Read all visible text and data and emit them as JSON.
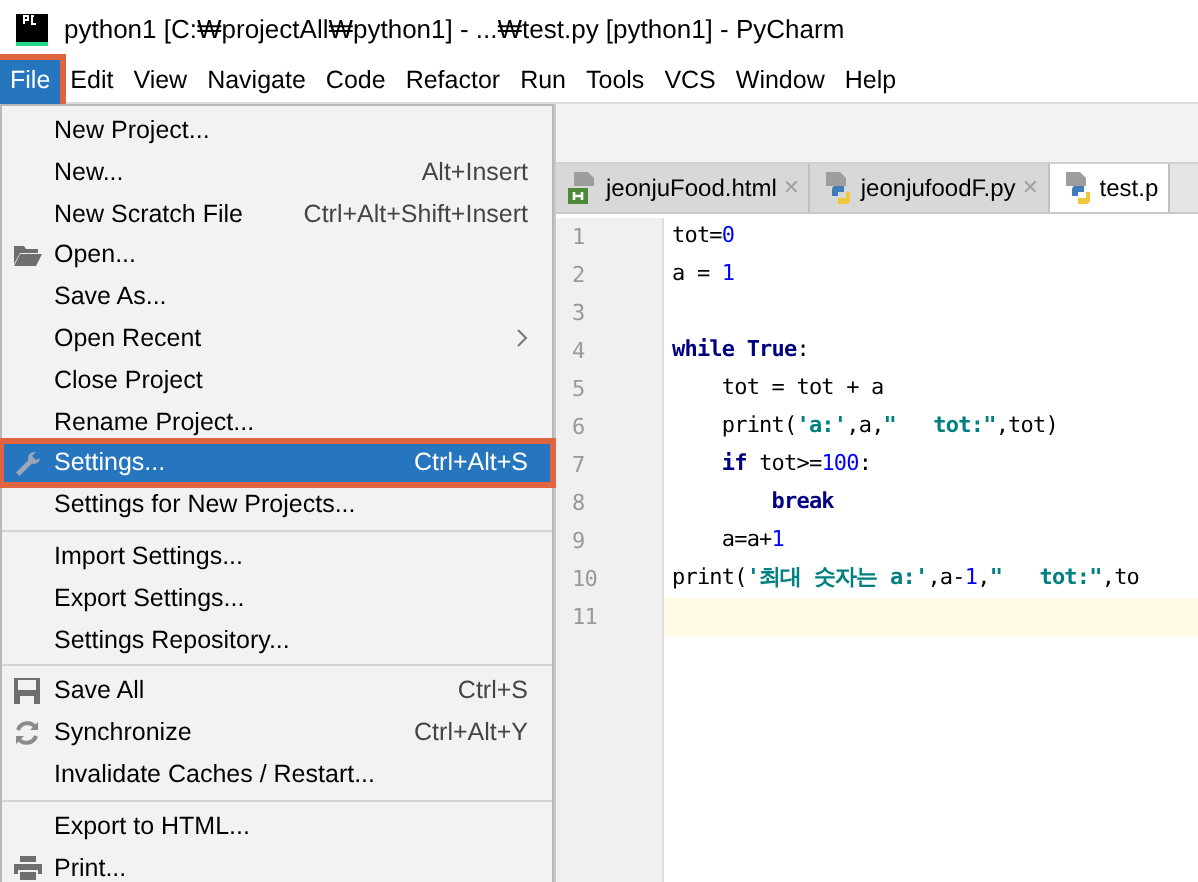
{
  "window": {
    "title": "python1 [C:₩projectAll₩python1] - ...₩test.py [python1] - PyCharm"
  },
  "menu_bar": [
    {
      "label": "File",
      "selected": true
    },
    {
      "label": "Edit",
      "selected": false
    },
    {
      "label": "View",
      "selected": false
    },
    {
      "label": "Navigate",
      "selected": false
    },
    {
      "label": "Code",
      "selected": false
    },
    {
      "label": "Refactor",
      "selected": false
    },
    {
      "label": "Run",
      "selected": false
    },
    {
      "label": "Tools",
      "selected": false
    },
    {
      "label": "VCS",
      "selected": false
    },
    {
      "label": "Window",
      "selected": false
    },
    {
      "label": "Help",
      "selected": false
    }
  ],
  "file_menu": [
    {
      "kind": "item",
      "label": "New Project...",
      "selected": false
    },
    {
      "kind": "item",
      "label": "New...",
      "shortcut": "Alt+Insert",
      "selected": false
    },
    {
      "kind": "item",
      "label": "New Scratch File",
      "shortcut": "Ctrl+Alt+Shift+Insert",
      "selected": false
    },
    {
      "kind": "item",
      "label": "Open...",
      "selected": false
    },
    {
      "kind": "item",
      "label": "Save As...",
      "selected": false
    },
    {
      "kind": "item",
      "label": "Open Recent",
      "submenu": true,
      "selected": false
    },
    {
      "kind": "item",
      "label": "Close Project",
      "selected": false
    },
    {
      "kind": "item",
      "label": "Rename Project...",
      "selected": false
    },
    {
      "kind": "item",
      "label": "Settings...",
      "shortcut": "Ctrl+Alt+S",
      "selected": true
    },
    {
      "kind": "item",
      "label": "Settings for New Projects...",
      "selected": false
    },
    {
      "kind": "separator"
    },
    {
      "kind": "item",
      "label": "Import Settings...",
      "selected": false
    },
    {
      "kind": "item",
      "label": "Export Settings...",
      "selected": false
    },
    {
      "kind": "item",
      "label": "Settings Repository...",
      "selected": false
    },
    {
      "kind": "separator"
    },
    {
      "kind": "item",
      "label": "Save All",
      "shortcut": "Ctrl+S",
      "selected": false
    },
    {
      "kind": "item",
      "label": "Synchronize",
      "shortcut": "Ctrl+Alt+Y",
      "selected": false
    },
    {
      "kind": "item",
      "label": "Invalidate Caches / Restart...",
      "selected": false
    },
    {
      "kind": "separator"
    },
    {
      "kind": "item",
      "label": "Export to HTML...",
      "selected": false
    },
    {
      "kind": "item",
      "label": "Print...",
      "selected": false
    }
  ],
  "editor_tabs": [
    {
      "label": "jeonjuFood.html",
      "kind": "html",
      "close": "✕",
      "selected": false
    },
    {
      "label": "jeonjufoodF.py",
      "kind": "python",
      "close": "✕",
      "selected": false
    },
    {
      "label": "test.p",
      "kind": "python",
      "selected": true
    }
  ],
  "code_lines": [
    {
      "number": "1",
      "current": false,
      "tokens": [
        {
          "kind": "plain",
          "text": "tot="
        },
        {
          "kind": "number",
          "text": "0"
        }
      ]
    },
    {
      "number": "2",
      "current": false,
      "tokens": [
        {
          "kind": "plain",
          "text": "a = "
        },
        {
          "kind": "number",
          "text": "1"
        }
      ]
    },
    {
      "number": "3",
      "current": false
    },
    {
      "number": "4",
      "current": false,
      "tokens": [
        {
          "kind": "keyword",
          "text": "while True"
        },
        {
          "kind": "plain",
          "text": ":"
        }
      ]
    },
    {
      "number": "5",
      "current": false,
      "tokens": [
        {
          "kind": "plain",
          "text": "    tot = tot + a"
        }
      ]
    },
    {
      "number": "6",
      "current": false,
      "tokens": [
        {
          "kind": "plain",
          "text": "    print("
        },
        {
          "kind": "string",
          "text": "'a:'"
        },
        {
          "kind": "plain",
          "text": ",a,"
        },
        {
          "kind": "string",
          "text": "\"   tot:\""
        },
        {
          "kind": "plain",
          "text": ",tot)"
        }
      ]
    },
    {
      "number": "7",
      "current": false,
      "tokens": [
        {
          "kind": "keyword",
          "text": "    if"
        },
        {
          "kind": "plain",
          "text": " tot>="
        },
        {
          "kind": "number",
          "text": "100"
        },
        {
          "kind": "plain",
          "text": ":"
        }
      ]
    },
    {
      "number": "8",
      "current": false,
      "tokens": [
        {
          "kind": "keyword",
          "text": "        break"
        }
      ]
    },
    {
      "number": "9",
      "current": false,
      "tokens": [
        {
          "kind": "plain",
          "text": "    a=a+"
        },
        {
          "kind": "number",
          "text": "1"
        }
      ]
    },
    {
      "number": "10",
      "current": false,
      "tokens": [
        {
          "kind": "plain",
          "text": "print("
        },
        {
          "kind": "string",
          "text": "'최대 숫자는 a:'"
        },
        {
          "kind": "plain",
          "text": ",a-"
        },
        {
          "kind": "number",
          "text": "1"
        },
        {
          "kind": "plain",
          "text": ","
        },
        {
          "kind": "string",
          "text": "\"   tot:\""
        },
        {
          "kind": "plain",
          "text": ",to"
        }
      ]
    },
    {
      "number": "11",
      "current": true
    }
  ]
}
